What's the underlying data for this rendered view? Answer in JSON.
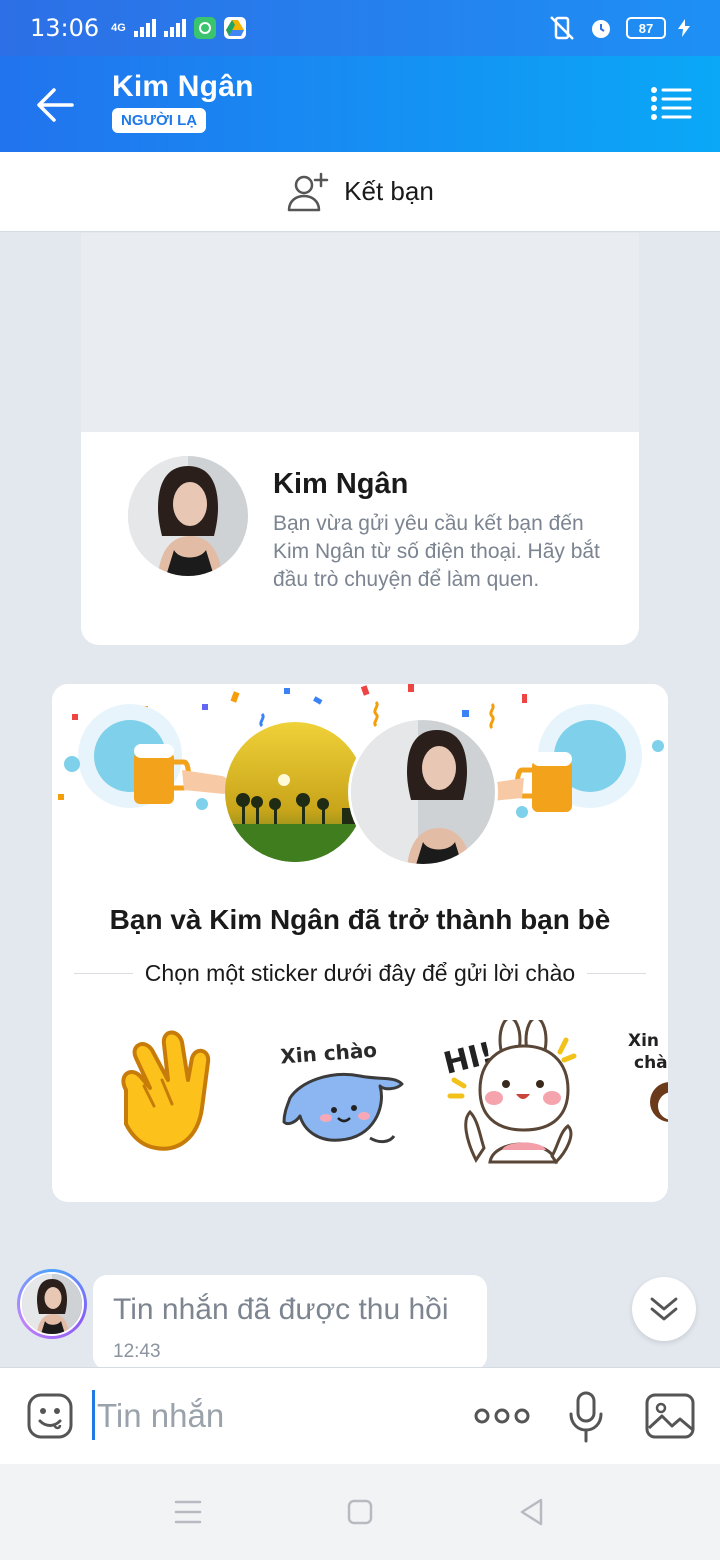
{
  "status_bar": {
    "time": "13:06",
    "network": "4G",
    "battery": "87"
  },
  "header": {
    "name": "Kim Ngân",
    "badge": "NGƯỜI LẠ"
  },
  "add_friend": {
    "label": "Kết bạn"
  },
  "profile_card": {
    "name": "Kim Ngân",
    "description": "Bạn vừa gửi yêu cầu kết bạn đến Kim Ngân từ số điện thoại. Hãy bắt đầu trò chuyện để làm quen."
  },
  "friends_card": {
    "title": "Bạn và Kim Ngân đã trở thành bạn bè",
    "hint": "Chọn một sticker dưới đây để gửi lời chào",
    "stickers": [
      {
        "name": "wave-hand"
      },
      {
        "name": "xin-chao-cat",
        "text": "Xin chào"
      },
      {
        "name": "hi-bunny",
        "text": "HI!"
      },
      {
        "name": "xin-chao-partial",
        "text": "Xin chà"
      }
    ]
  },
  "message": {
    "text": "Tin nhắn đã được thu hồi",
    "time": "12:43"
  },
  "composer": {
    "placeholder": "Tin nhắn"
  },
  "colors": {
    "header_start": "#2273ee",
    "header_end": "#0aa8f7",
    "accent": "#1f7ae6",
    "chat_background": "#e3e8ef"
  }
}
